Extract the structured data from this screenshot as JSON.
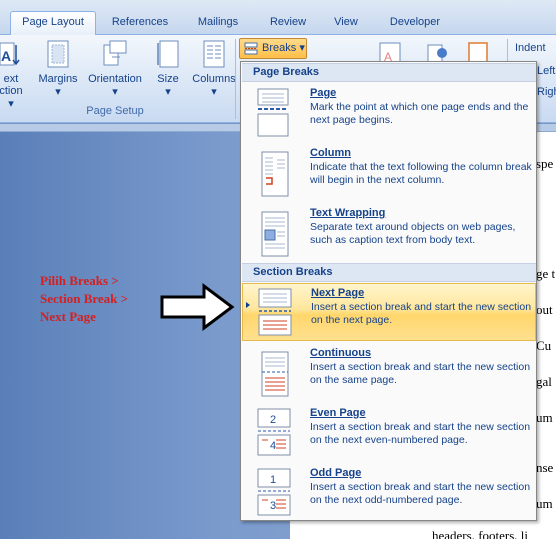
{
  "tabs": [
    {
      "label": "Page Layout",
      "active": true
    },
    {
      "label": "References",
      "active": false
    },
    {
      "label": "Mailings",
      "active": false
    },
    {
      "label": "Review",
      "active": false
    },
    {
      "label": "View",
      "active": false
    },
    {
      "label": "Developer",
      "active": false
    }
  ],
  "ribbon": {
    "text_direction_line1": "ext",
    "text_direction_line2": "ction",
    "margins": "Margins",
    "orientation": "Orientation",
    "size": "Size",
    "columns": "Columns",
    "breaks": "Breaks",
    "group_label": "Page Setup",
    "indent": "Indent",
    "left_partial": "Left",
    "right_partial": "Righ"
  },
  "menu": {
    "page_breaks_header": "Page Breaks",
    "section_breaks_header": "Section Breaks",
    "items": [
      {
        "title": "Page",
        "desc": "Mark the point at which one page ends and the next page begins.",
        "icon": "page-break-icon"
      },
      {
        "title": "Column",
        "desc": "Indicate that the text following the column break will begin in the next column.",
        "icon": "column-break-icon"
      },
      {
        "title": "Text Wrapping",
        "desc": "Separate text around objects on web pages, such as caption text from body text.",
        "icon": "text-wrapping-icon"
      },
      {
        "title": "Next Page",
        "desc": "Insert a section break and start the new section on the next page.",
        "icon": "next-page-icon",
        "highlighted": true
      },
      {
        "title": "Continuous",
        "desc": "Insert a section break and start the new section on the same page.",
        "icon": "continuous-icon"
      },
      {
        "title": "Even Page",
        "desc": "Insert a section break and start the new section on the next even-numbered page.",
        "icon": "even-page-icon"
      },
      {
        "title": "Odd Page",
        "desc": "Insert a section break and start the new section on the next odd-numbered page.",
        "icon": "odd-page-icon"
      }
    ]
  },
  "annotation": {
    "line1": "Pilih Breaks >",
    "line2": "Section Break >",
    "line3": "Next Page"
  },
  "document": {
    "frag1": "spe",
    "frag2": "ge t",
    "frag3": "out",
    "frag4": "Cu",
    "frag5": "gal",
    "frag6": "um",
    "frag7": "nse",
    "frag8": "um",
    "frag9": "headers, footers, li"
  },
  "colors": {
    "highlight": "#ffe08f",
    "annotation": "#d42020",
    "ribbon_text": "#15428b"
  }
}
